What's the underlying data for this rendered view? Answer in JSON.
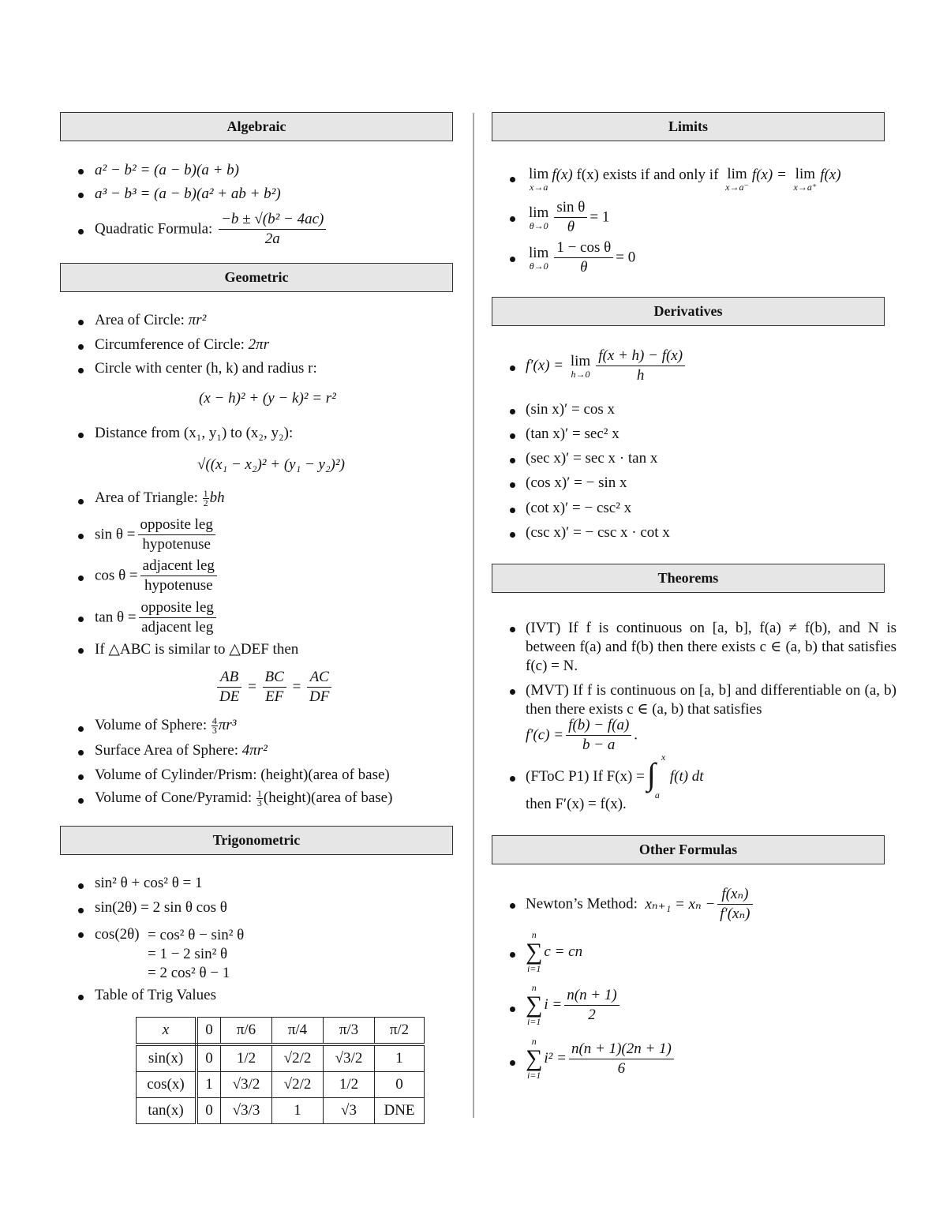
{
  "sections": {
    "algebraic": {
      "title": "Algebraic",
      "items": [
        "a² − b² = (a − b)(a + b)",
        "a³ − b³ = (a − b)(a² + ab + b²)"
      ],
      "quadratic": {
        "label": "Quadratic Formula:",
        "numerator": "−b ± √(b² − 4ac)",
        "denominator": "2a"
      }
    },
    "geometric": {
      "title": "Geometric",
      "area_circle": {
        "label": "Area of Circle:",
        "formula": "πr²"
      },
      "circumference": {
        "label": "Circumference of Circle:",
        "formula": "2πr"
      },
      "circle_eq": {
        "label": "Circle with center (h, k) and radius r:",
        "formula": "(x − h)² + (y − k)² = r²"
      },
      "distance": {
        "label": "Distance from (x₁, y₁) to (x₂, y₂):",
        "formula": "√((x₁ − x₂)² + (y₁ − y₂)²)"
      },
      "triangle": {
        "label": "Area of Triangle:",
        "coef_num": "1",
        "coef_den": "2",
        "formula": "bh"
      },
      "sin": {
        "lhs": "sin θ =",
        "num": "opposite leg",
        "den": "hypotenuse"
      },
      "cos": {
        "lhs": "cos θ =",
        "num": "adjacent leg",
        "den": "hypotenuse"
      },
      "tan": {
        "lhs": "tan θ =",
        "num": "opposite leg",
        "den": "adjacent leg"
      },
      "similar": {
        "label": "If △ABC is similar to △DEF then",
        "ratios": [
          {
            "num": "AB",
            "den": "DE"
          },
          {
            "num": "BC",
            "den": "EF"
          },
          {
            "num": "AC",
            "den": "DF"
          }
        ]
      },
      "sphere_volume": {
        "label": "Volume of Sphere:",
        "coef_num": "4",
        "coef_den": "3",
        "formula": "πr³"
      },
      "sphere_surface": {
        "label": "Surface Area of Sphere:",
        "formula": "4πr²"
      },
      "cylinder": {
        "label": "Volume of Cylinder/Prism:",
        "formula": "(height)(area of base)"
      },
      "cone": {
        "label": "Volume of Cone/Pyramid:",
        "coef_num": "1",
        "coef_den": "3",
        "formula": "(height)(area of base)"
      }
    },
    "trigonometric": {
      "title": "Trigonometric",
      "identity1": "sin² θ + cos² θ = 1",
      "identity2": "sin(2θ) = 2 sin θ cos θ",
      "cos2": {
        "lhs": "cos(2θ)",
        "lines": [
          "= cos² θ − sin² θ",
          "= 1 − 2 sin² θ",
          "= 2 cos² θ − 1"
        ]
      },
      "table_label": "Table of Trig Values",
      "table": {
        "header": [
          "x",
          "0",
          "π/6",
          "π/4",
          "π/3",
          "π/2"
        ],
        "rows": [
          [
            "sin(x)",
            "0",
            "1/2",
            "√2/2",
            "√3/2",
            "1"
          ],
          [
            "cos(x)",
            "1",
            "√3/2",
            "√2/2",
            "1/2",
            "0"
          ],
          [
            "tan(x)",
            "0",
            "√3/3",
            "1",
            "√3",
            "DNE"
          ]
        ]
      }
    },
    "limits": {
      "title": "Limits",
      "item1": {
        "lim_sub": "x→a",
        "text": "f(x) exists if and only if",
        "lim_left_sub": "x→a⁻",
        "mid": "f(x) =",
        "lim_right_sub": "x→a⁺",
        "end": "f(x)"
      },
      "item2": {
        "lim_sub": "θ→0",
        "num": "sin θ",
        "den": "θ",
        "rhs": "= 1"
      },
      "item3": {
        "lim_sub": "θ→0",
        "num": "1 − cos θ",
        "den": "θ",
        "rhs": "= 0"
      },
      "lim_word": "lim"
    },
    "derivatives": {
      "title": "Derivatives",
      "definition": {
        "lhs": "f′(x) =",
        "lim_sub": "h→0",
        "num": "f(x + h) − f(x)",
        "den": "h"
      },
      "items": [
        "(sin x)′ = cos x",
        "(tan x)′ = sec² x",
        "(sec x)′ = sec x · tan x",
        "(cos x)′ = − sin x",
        "(cot x)′ = − csc² x",
        "(csc x)′ = − csc x · cot x"
      ]
    },
    "theorems": {
      "title": "Theorems",
      "ivt": "(IVT) If f is continuous on [a, b], f(a) ≠ f(b), and N is between f(a) and f(b) then there exists c ∈ (a, b) that satisfies f(c) = N.",
      "mvt_text": "(MVT) If f is continuous on [a, b] and differentiable on (a, b) then there exists c ∈ (a, b) that satisfies",
      "mvt_formula": {
        "lhs": "f′(c) =",
        "num": "f(b) − f(a)",
        "den": "b − a",
        "end": "."
      },
      "ftoc": {
        "lead": "(FToC P1) If F(x) =",
        "upper": "x",
        "lower": "a",
        "integrand": "f(t) dt",
        "then": "then F′(x) = f(x)."
      }
    },
    "other": {
      "title": "Other Formulas",
      "newton": {
        "label": "Newton’s Method:",
        "lhs": "xₙ₊₁ = xₙ −",
        "num": "f(xₙ)",
        "den": "f′(xₙ)"
      },
      "sums": [
        {
          "upper": "n",
          "lower": "i=1",
          "body": "c = cn",
          "num": "",
          "den": ""
        },
        {
          "upper": "n",
          "lower": "i=1",
          "body": "i =",
          "num": "n(n + 1)",
          "den": "2"
        },
        {
          "upper": "n",
          "lower": "i=1",
          "body": "i² =",
          "num": "n(n + 1)(2n + 1)",
          "den": "6"
        }
      ]
    }
  }
}
